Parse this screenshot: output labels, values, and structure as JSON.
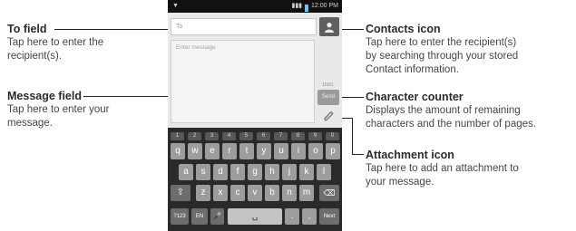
{
  "annotations": {
    "to_field": {
      "title": "To field",
      "desc": [
        "Tap here to enter the",
        "recipient(s)."
      ]
    },
    "message_field": {
      "title": "Message field",
      "desc": [
        "Tap here to enter your",
        "message."
      ]
    },
    "contacts_icon": {
      "title": "Contacts icon",
      "desc": [
        "Tap here to enter the recipient(s)",
        "by searching through your stored",
        "Contact information."
      ]
    },
    "character_counter": {
      "title": "Character counter",
      "desc": [
        "Displays the amount of remaining",
        "characters and the number of pages."
      ]
    },
    "attachment_icon": {
      "title": "Attachment icon",
      "desc": [
        "Tap here to add an attachment to",
        "your message."
      ]
    }
  },
  "status_bar": {
    "time": "12:00 PM"
  },
  "compose": {
    "to_placeholder": "To",
    "message_placeholder": "Enter message",
    "counter": "160/1",
    "send_label": "Send"
  },
  "keyboard": {
    "numbers": [
      "1",
      "2",
      "3",
      "4",
      "5",
      "6",
      "7",
      "8",
      "9",
      "0"
    ],
    "row1": [
      "q",
      "w",
      "e",
      "r",
      "t",
      "y",
      "u",
      "i",
      "o",
      "p"
    ],
    "row2": [
      "a",
      "s",
      "d",
      "f",
      "g",
      "h",
      "j",
      "k",
      "l"
    ],
    "row3": [
      "z",
      "x",
      "c",
      "v",
      "b",
      "n",
      "m"
    ],
    "symbols_label": "?123",
    "lang_label": "EN",
    "next_label": "Next",
    "period": ".",
    "comma": ","
  },
  "colors": {
    "keyboard_bg": "#2a2a2a",
    "key": "#9d9d9d",
    "compose_bg": "#e9e9e9"
  }
}
